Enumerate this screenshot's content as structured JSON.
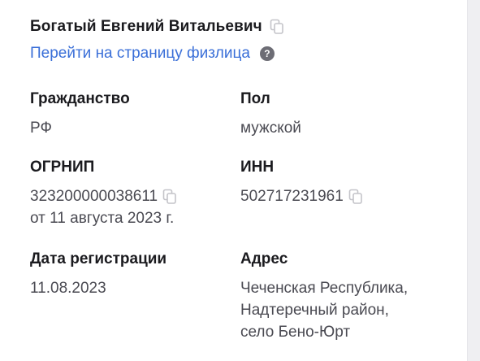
{
  "person": {
    "name": "Богатый Евгений Витальевич",
    "link_label": "Перейти на страницу физлица",
    "help_glyph": "?"
  },
  "fields": {
    "citizenship": {
      "label": "Гражданство",
      "value": "РФ"
    },
    "gender": {
      "label": "Пол",
      "value": "мужской"
    },
    "ogrnip": {
      "label": "ОГРНИП",
      "value": "323200000038611",
      "date": "от 11 августа 2023 г."
    },
    "inn": {
      "label": "ИНН",
      "value": "502717231961"
    },
    "registration_date": {
      "label": "Дата регистрации",
      "value": "11.08.2023"
    },
    "address": {
      "label": "Адрес",
      "lines": [
        "Чеченская Республика,",
        "Надтеречный район,",
        "село Бено-Юрт"
      ]
    }
  },
  "icons": {
    "copy": "copy-icon",
    "help": "help-icon"
  },
  "colors": {
    "link": "#3a6fd8",
    "label": "#1b1b1f",
    "value": "#4a4a52",
    "icon": "#c4c4c9",
    "help_bg": "#6d6d75"
  }
}
